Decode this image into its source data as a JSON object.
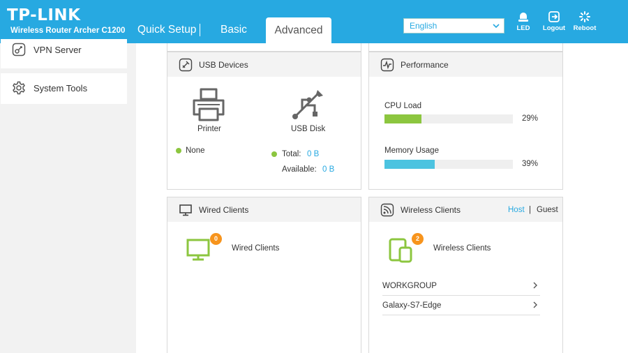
{
  "header": {
    "logo": "TP-LINK",
    "model": "Wireless Router Archer C1200",
    "tabs": {
      "quick_setup": "Quick Setup",
      "basic": "Basic",
      "advanced": "Advanced"
    },
    "language": "English",
    "buttons": {
      "led": "LED",
      "logout": "Logout",
      "reboot": "Reboot"
    }
  },
  "sidebar": {
    "items": [
      {
        "label": "VPN Server",
        "icon": "vpn-icon"
      },
      {
        "label": "System Tools",
        "icon": "gear-icon"
      }
    ]
  },
  "usb_devices": {
    "title": "USB Devices",
    "printer_label": "Printer",
    "printer_status": "None",
    "usb_disk_label": "USB Disk",
    "total_label": "Total:",
    "total_value": "0 B",
    "available_label": "Available:",
    "available_value": "0 B"
  },
  "performance": {
    "title": "Performance",
    "cpu_label": "CPU Load",
    "cpu_value": "29%",
    "cpu_fraction": 0.29,
    "memory_label": "Memory Usage",
    "memory_value": "39%",
    "memory_fraction": 0.39
  },
  "wired_clients": {
    "title": "Wired Clients",
    "count": "0",
    "label": "Wired Clients"
  },
  "wireless_clients": {
    "title": "Wireless Clients",
    "host": "Host",
    "separator": "|",
    "guest": "Guest",
    "count": "2",
    "label": "Wireless Clients",
    "clients": [
      "WORKGROUP",
      "Galaxy-S7-Edge"
    ]
  },
  "colors": {
    "brand": "#27a9e1",
    "cpu_bar": "#8cc63f",
    "memory_bar": "#4cc3e0",
    "badge": "#f7941d",
    "client_icon": "#8cc63f"
  }
}
